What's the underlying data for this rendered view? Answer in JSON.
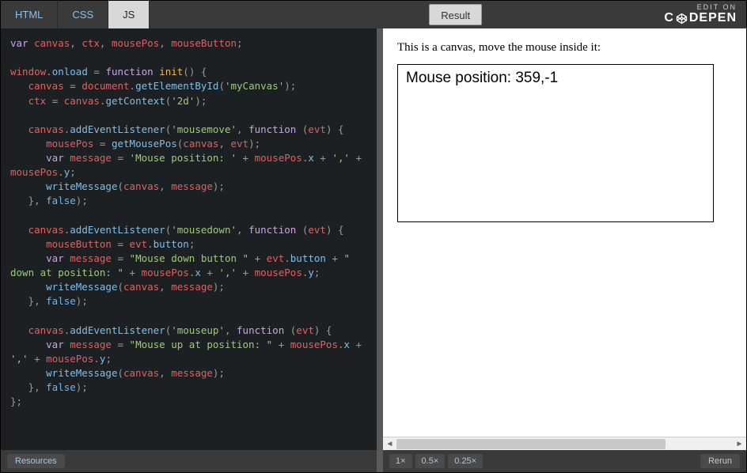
{
  "header": {
    "tabs": {
      "html": "HTML",
      "css": "CSS",
      "js": "JS"
    },
    "edit_on": "EDIT ON",
    "brand": "CODEPEN"
  },
  "editor": {
    "code_tokens": [
      [
        [
          "kw",
          "var"
        ],
        [
          "pr",
          " "
        ],
        [
          "id",
          "canvas"
        ],
        [
          "op",
          ", "
        ],
        [
          "id",
          "ctx"
        ],
        [
          "op",
          ", "
        ],
        [
          "id",
          "mousePos"
        ],
        [
          "op",
          ", "
        ],
        [
          "id",
          "mouseButton"
        ],
        [
          "op",
          ";"
        ]
      ],
      [],
      [
        [
          "id",
          "window"
        ],
        [
          "op",
          "."
        ],
        [
          "fn",
          "onload"
        ],
        [
          "pr",
          " "
        ],
        [
          "op",
          "="
        ],
        [
          "pr",
          " "
        ],
        [
          "kw",
          "function"
        ],
        [
          "pr",
          " "
        ],
        [
          "wn",
          "init"
        ],
        [
          "op",
          "() {"
        ]
      ],
      [
        [
          "pr",
          "   "
        ],
        [
          "id",
          "canvas"
        ],
        [
          "pr",
          " "
        ],
        [
          "op",
          "="
        ],
        [
          "pr",
          " "
        ],
        [
          "id",
          "document"
        ],
        [
          "op",
          "."
        ],
        [
          "fn",
          "getElementById"
        ],
        [
          "op",
          "("
        ],
        [
          "st",
          "'myCanvas'"
        ],
        [
          "op",
          ");"
        ]
      ],
      [
        [
          "pr",
          "   "
        ],
        [
          "id",
          "ctx"
        ],
        [
          "pr",
          " "
        ],
        [
          "op",
          "="
        ],
        [
          "pr",
          " "
        ],
        [
          "id",
          "canvas"
        ],
        [
          "op",
          "."
        ],
        [
          "fn",
          "getContext"
        ],
        [
          "op",
          "("
        ],
        [
          "st",
          "'2d'"
        ],
        [
          "op",
          ");"
        ]
      ],
      [],
      [
        [
          "pr",
          "   "
        ],
        [
          "id",
          "canvas"
        ],
        [
          "op",
          "."
        ],
        [
          "fn",
          "addEventListener"
        ],
        [
          "op",
          "("
        ],
        [
          "st",
          "'mousemove'"
        ],
        [
          "op",
          ", "
        ],
        [
          "kw",
          "function"
        ],
        [
          "pr",
          " "
        ],
        [
          "op",
          "("
        ],
        [
          "id",
          "evt"
        ],
        [
          "op",
          ") {"
        ]
      ],
      [
        [
          "pr",
          "      "
        ],
        [
          "id",
          "mousePos"
        ],
        [
          "pr",
          " "
        ],
        [
          "op",
          "="
        ],
        [
          "pr",
          " "
        ],
        [
          "fn",
          "getMousePos"
        ],
        [
          "op",
          "("
        ],
        [
          "id",
          "canvas"
        ],
        [
          "op",
          ", "
        ],
        [
          "id",
          "evt"
        ],
        [
          "op",
          ");"
        ]
      ],
      [
        [
          "pr",
          "      "
        ],
        [
          "kw",
          "var"
        ],
        [
          "pr",
          " "
        ],
        [
          "id",
          "message"
        ],
        [
          "pr",
          " "
        ],
        [
          "op",
          "="
        ],
        [
          "pr",
          " "
        ],
        [
          "st",
          "'Mouse position: '"
        ],
        [
          "pr",
          " "
        ],
        [
          "op",
          "+"
        ],
        [
          "pr",
          " "
        ],
        [
          "id",
          "mousePos"
        ],
        [
          "op",
          "."
        ],
        [
          "fn",
          "x"
        ],
        [
          "pr",
          " "
        ],
        [
          "op",
          "+"
        ],
        [
          "pr",
          " "
        ],
        [
          "st",
          "','"
        ],
        [
          "pr",
          " "
        ],
        [
          "op",
          "+"
        ]
      ],
      [
        [
          "id",
          "mousePos"
        ],
        [
          "op",
          "."
        ],
        [
          "fn",
          "y"
        ],
        [
          "op",
          ";"
        ]
      ],
      [
        [
          "pr",
          "      "
        ],
        [
          "fn",
          "writeMessage"
        ],
        [
          "op",
          "("
        ],
        [
          "id",
          "canvas"
        ],
        [
          "op",
          ", "
        ],
        [
          "id",
          "message"
        ],
        [
          "op",
          ");"
        ]
      ],
      [
        [
          "pr",
          "   "
        ],
        [
          "op",
          "}, "
        ],
        [
          "bl",
          "false"
        ],
        [
          "op",
          ");"
        ]
      ],
      [],
      [
        [
          "pr",
          "   "
        ],
        [
          "id",
          "canvas"
        ],
        [
          "op",
          "."
        ],
        [
          "fn",
          "addEventListener"
        ],
        [
          "op",
          "("
        ],
        [
          "st",
          "'mousedown'"
        ],
        [
          "op",
          ", "
        ],
        [
          "kw",
          "function"
        ],
        [
          "pr",
          " "
        ],
        [
          "op",
          "("
        ],
        [
          "id",
          "evt"
        ],
        [
          "op",
          ") {"
        ]
      ],
      [
        [
          "pr",
          "      "
        ],
        [
          "id",
          "mouseButton"
        ],
        [
          "pr",
          " "
        ],
        [
          "op",
          "="
        ],
        [
          "pr",
          " "
        ],
        [
          "id",
          "evt"
        ],
        [
          "op",
          "."
        ],
        [
          "fn",
          "button"
        ],
        [
          "op",
          ";"
        ]
      ],
      [
        [
          "pr",
          "      "
        ],
        [
          "kw",
          "var"
        ],
        [
          "pr",
          " "
        ],
        [
          "id",
          "message"
        ],
        [
          "pr",
          " "
        ],
        [
          "op",
          "="
        ],
        [
          "pr",
          " "
        ],
        [
          "st",
          "\"Mouse down button \""
        ],
        [
          "pr",
          " "
        ],
        [
          "op",
          "+"
        ],
        [
          "pr",
          " "
        ],
        [
          "id",
          "evt"
        ],
        [
          "op",
          "."
        ],
        [
          "fn",
          "button"
        ],
        [
          "pr",
          " "
        ],
        [
          "op",
          "+"
        ],
        [
          "pr",
          " "
        ],
        [
          "st",
          "\""
        ]
      ],
      [
        [
          "st",
          "down at position: \""
        ],
        [
          "pr",
          " "
        ],
        [
          "op",
          "+"
        ],
        [
          "pr",
          " "
        ],
        [
          "id",
          "mousePos"
        ],
        [
          "op",
          "."
        ],
        [
          "fn",
          "x"
        ],
        [
          "pr",
          " "
        ],
        [
          "op",
          "+"
        ],
        [
          "pr",
          " "
        ],
        [
          "st",
          "','"
        ],
        [
          "pr",
          " "
        ],
        [
          "op",
          "+"
        ],
        [
          "pr",
          " "
        ],
        [
          "id",
          "mousePos"
        ],
        [
          "op",
          "."
        ],
        [
          "fn",
          "y"
        ],
        [
          "op",
          ";"
        ]
      ],
      [
        [
          "pr",
          "      "
        ],
        [
          "fn",
          "writeMessage"
        ],
        [
          "op",
          "("
        ],
        [
          "id",
          "canvas"
        ],
        [
          "op",
          ", "
        ],
        [
          "id",
          "message"
        ],
        [
          "op",
          ");"
        ]
      ],
      [
        [
          "pr",
          "   "
        ],
        [
          "op",
          "}, "
        ],
        [
          "bl",
          "false"
        ],
        [
          "op",
          ");"
        ]
      ],
      [],
      [
        [
          "pr",
          "   "
        ],
        [
          "id",
          "canvas"
        ],
        [
          "op",
          "."
        ],
        [
          "fn",
          "addEventListener"
        ],
        [
          "op",
          "("
        ],
        [
          "st",
          "'mouseup'"
        ],
        [
          "op",
          ", "
        ],
        [
          "kw",
          "function"
        ],
        [
          "pr",
          " "
        ],
        [
          "op",
          "("
        ],
        [
          "id",
          "evt"
        ],
        [
          "op",
          ") {"
        ]
      ],
      [
        [
          "pr",
          "      "
        ],
        [
          "kw",
          "var"
        ],
        [
          "pr",
          " "
        ],
        [
          "id",
          "message"
        ],
        [
          "pr",
          " "
        ],
        [
          "op",
          "="
        ],
        [
          "pr",
          " "
        ],
        [
          "st",
          "\"Mouse up at position: \""
        ],
        [
          "pr",
          " "
        ],
        [
          "op",
          "+"
        ],
        [
          "pr",
          " "
        ],
        [
          "id",
          "mousePos"
        ],
        [
          "op",
          "."
        ],
        [
          "fn",
          "x"
        ],
        [
          "pr",
          " "
        ],
        [
          "op",
          "+"
        ]
      ],
      [
        [
          "st",
          "','"
        ],
        [
          "pr",
          " "
        ],
        [
          "op",
          "+"
        ],
        [
          "pr",
          " "
        ],
        [
          "id",
          "mousePos"
        ],
        [
          "op",
          "."
        ],
        [
          "fn",
          "y"
        ],
        [
          "op",
          ";"
        ]
      ],
      [
        [
          "pr",
          "      "
        ],
        [
          "fn",
          "writeMessage"
        ],
        [
          "op",
          "("
        ],
        [
          "id",
          "canvas"
        ],
        [
          "op",
          ", "
        ],
        [
          "id",
          "message"
        ],
        [
          "op",
          ");"
        ]
      ],
      [
        [
          "pr",
          "   "
        ],
        [
          "op",
          "}, "
        ],
        [
          "bl",
          "false"
        ],
        [
          "op",
          ");"
        ]
      ],
      [
        [
          "op",
          "};"
        ]
      ]
    ],
    "resources_btn": "Resources"
  },
  "result": {
    "button": "Result",
    "intro": "This is a canvas, move the mouse inside it:",
    "canvas_text": "Mouse position: 359,-1",
    "zoom": {
      "z1": "1×",
      "z05": "0.5×",
      "z025": "0.25×"
    },
    "rerun": "Rerun"
  }
}
